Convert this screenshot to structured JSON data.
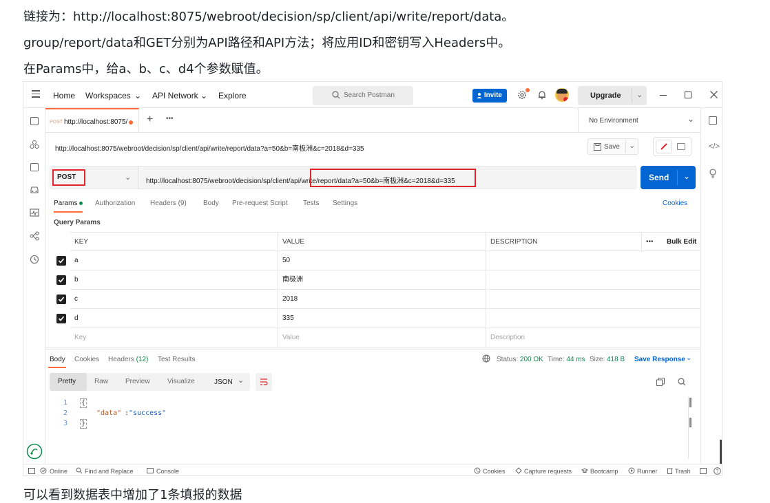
{
  "doc": {
    "line1": "链接为：http://localhost:8075/webroot/decision/sp/client/api/write/report/data。",
    "line2": "group/report/data和GET分别为API路径和API方法；将应用ID和密钥写入Headers中。",
    "line3": "在Params中，给a、b、c、d4个参数赋值。",
    "line4": "可以看到数据表中增加了1条填报的数据"
  },
  "topbar": {
    "home": "Home",
    "workspaces": "Workspaces",
    "api_network": "API Network",
    "explore": "Explore",
    "search_placeholder": "Search Postman",
    "invite": "Invite",
    "upgrade": "Upgrade"
  },
  "tab": {
    "method": "POST",
    "url": "http://localhost:8075/",
    "environment": "No Environment"
  },
  "request": {
    "title_url": "http://localhost:8075/webroot/decision/sp/client/api/write/report/data?a=50&b=南极洲&c=2018&d=335",
    "save": "Save",
    "method": "POST",
    "url_prefix": "http://localhost:8075/webroot/decision/sp/client/api/",
    "url_highlight": "write/report/data?a=50&b=南极洲&c=2018&d=335",
    "send": "Send"
  },
  "subtabs": {
    "params": "Params",
    "authorization": "Authorization",
    "headers": "Headers (9)",
    "body": "Body",
    "prerequest": "Pre-request Script",
    "tests": "Tests",
    "settings": "Settings",
    "cookies": "Cookies"
  },
  "query_params": {
    "title": "Query Params",
    "col_key": "KEY",
    "col_value": "VALUE",
    "col_desc": "DESCRIPTION",
    "bulk_edit": "Bulk Edit",
    "rows": [
      {
        "key": "a",
        "value": "50"
      },
      {
        "key": "b",
        "value": "南极洲"
      },
      {
        "key": "c",
        "value": "2018"
      },
      {
        "key": "d",
        "value": "335"
      }
    ],
    "placeholder_key": "Key",
    "placeholder_value": "Value",
    "placeholder_desc": "Description"
  },
  "response": {
    "tabs": {
      "body": "Body",
      "cookies": "Cookies",
      "headers": "Headers",
      "headers_count": "(12)",
      "test_results": "Test Results"
    },
    "status_label": "Status:",
    "status_value": "200 OK",
    "time_label": "Time:",
    "time_value": "44 ms",
    "size_label": "Size:",
    "size_value": "418 B",
    "save_response": "Save Response",
    "formats": {
      "pretty": "Pretty",
      "raw": "Raw",
      "preview": "Preview",
      "visualize": "Visualize"
    },
    "lang": "JSON",
    "lines": [
      "1",
      "2",
      "3"
    ],
    "open_brace": "{",
    "key": "\"data\"",
    "colon": ": ",
    "value": "\"success\"",
    "close_brace": "}"
  },
  "footer": {
    "online": "Online",
    "find_replace": "Find and Replace",
    "console": "Console",
    "cookies": "Cookies",
    "capture": "Capture requests",
    "bootcamp": "Bootcamp",
    "runner": "Runner",
    "trash": "Trash"
  }
}
